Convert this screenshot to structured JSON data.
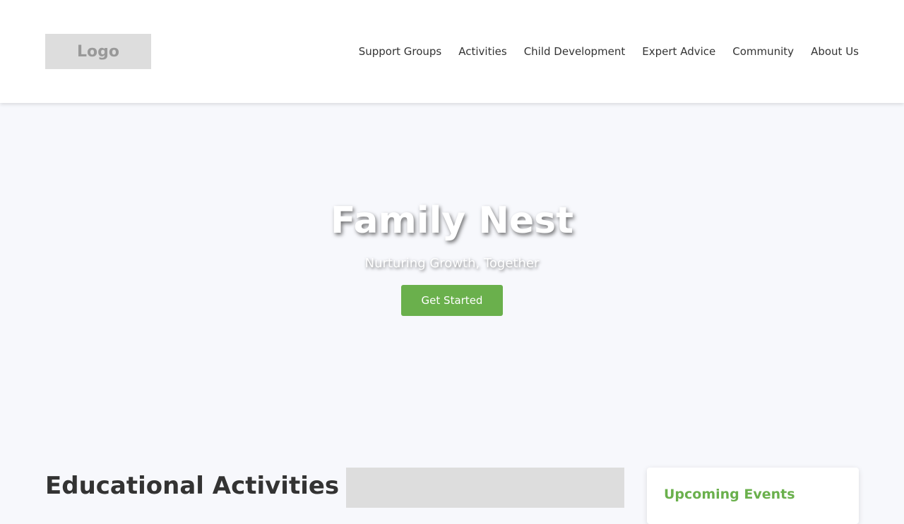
{
  "header": {
    "logo_text": "Logo",
    "nav": [
      {
        "label": "Support Groups"
      },
      {
        "label": "Activities"
      },
      {
        "label": "Child Development"
      },
      {
        "label": "Expert Advice"
      },
      {
        "label": "Community"
      },
      {
        "label": "About Us"
      }
    ]
  },
  "hero": {
    "title": "Family Nest",
    "subtitle": "Nurturing Growth, Together",
    "cta_label": "Get Started"
  },
  "content": {
    "section_title": "Educational Activities",
    "events_title": "Upcoming Events"
  },
  "colors": {
    "accent": "#6ab04c",
    "background": "#f7f8fc",
    "text": "#333333",
    "placeholder": "#dddddd"
  }
}
